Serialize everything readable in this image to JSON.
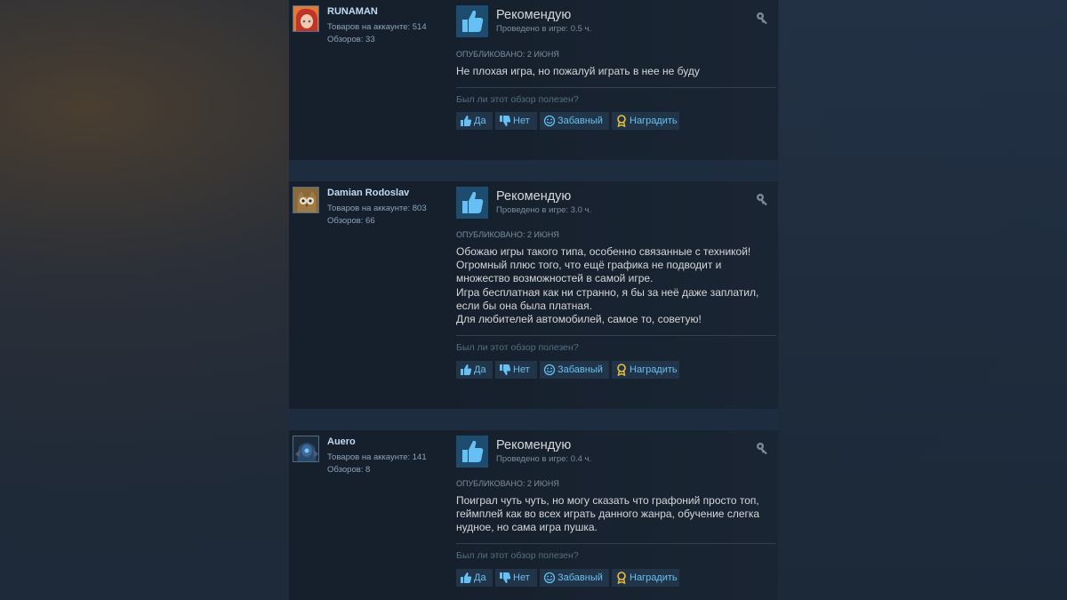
{
  "colors": {
    "accent": "#66c0f4",
    "recommend_box": "#1d4c6e",
    "review_bg": "#16202d"
  },
  "reviews": [
    {
      "author": "RUNAMAN",
      "products_label": "Товаров на аккаунте: 514",
      "reviews_label": "Обзоров: 33",
      "recommendation": "Рекомендую",
      "hours": "Проведено в игре: 0.5 ч.",
      "posted": "ОПУБЛИКОВАНО: 2 ИЮНЯ",
      "text": [
        "Не плохая игра, но пожалуй играть в нее не буду"
      ],
      "helpful_question": "Был ли этот обзор полезен?",
      "buttons": {
        "yes": "Да",
        "no": "Нет",
        "funny": "Забавный",
        "award": "Наградить"
      },
      "avatar_icon": "avatar-anime-icon"
    },
    {
      "author": "Damian Rodoslav",
      "products_label": "Товаров на аккаунте: 803",
      "reviews_label": "Обзоров: 66",
      "recommendation": "Рекомендую",
      "hours": "Проведено в игре: 3.0 ч.",
      "posted": "ОПУБЛИКОВАНО: 2 ИЮНЯ",
      "text": [
        "Обожаю игры такого типа, особенно связанные с техникой!",
        "Огромный плюс того, что ещё графика не подводит и",
        "множество возможностей в самой игре.",
        "Игра бесплатная как ни странно, я бы за неё даже заплатил,",
        "если бы она была платная.",
        "Для любителей автомобилей, самое то, советую!"
      ],
      "helpful_question": "Был ли этот обзор полезен?",
      "buttons": {
        "yes": "Да",
        "no": "Нет",
        "funny": "Забавный",
        "award": "Наградить"
      },
      "avatar_icon": "avatar-owl-icon"
    },
    {
      "author": "Auero",
      "products_label": "Товаров на аккаунте: 141",
      "reviews_label": "Обзоров: 8",
      "recommendation": "Рекомендую",
      "hours": "Проведено в игре: 0.4 ч.",
      "posted": "ОПУБЛИКОВАНО: 2 ИЮНЯ",
      "text": [
        "Поиграл чуть чуть, но могу сказать что графоний просто топ,",
        "геймплей как во всех играть данного жанра, обучение слегка",
        "нудное, но сама игра пушка."
      ],
      "helpful_question": "Был ли этот обзор полезен?",
      "buttons": {
        "yes": "Да",
        "no": "Нет",
        "funny": "Забавный",
        "award": "Наградить"
      },
      "avatar_icon": "avatar-dark-character-icon"
    }
  ]
}
